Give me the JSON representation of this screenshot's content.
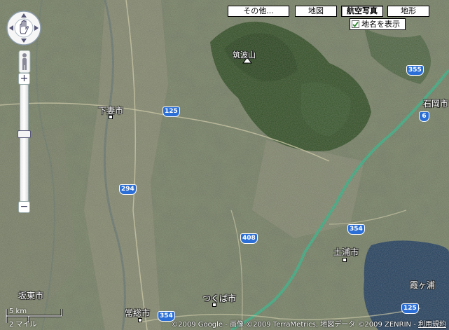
{
  "map_types": {
    "other": "その他...",
    "map": "地図",
    "satellite": "航空写真",
    "terrain": "地形",
    "active": "satellite"
  },
  "label_toggle": {
    "label": "地名を表示",
    "checked": true
  },
  "places": {
    "shimotsuma": "下妻市",
    "ishioka": "石岡市",
    "tsuchiura": "土浦市",
    "bando": "坂東市",
    "joso": "常総市",
    "tsukuba": "つくば市",
    "kasumigaura": "霞ヶ浦",
    "tsukubasan": "筑波山"
  },
  "routes": {
    "r125_a": "125",
    "r355": "355",
    "r6": "6",
    "r294": "294",
    "r408": "408",
    "r354_a": "354",
    "r354_b": "354",
    "r125_b": "125"
  },
  "scale": {
    "km": "5 km",
    "mi": "2 マイル"
  },
  "copyright": {
    "text": "©2009 Google - 画像 ©2009 TerraMetrics, 地図データ ©2009 ZENRIN - ",
    "terms": "利用規約"
  },
  "colors": {
    "water": "#1f3b5a",
    "forest": "#2e4a22",
    "expressway": "#3aa37a",
    "route_shield": "#2b6fd6"
  }
}
